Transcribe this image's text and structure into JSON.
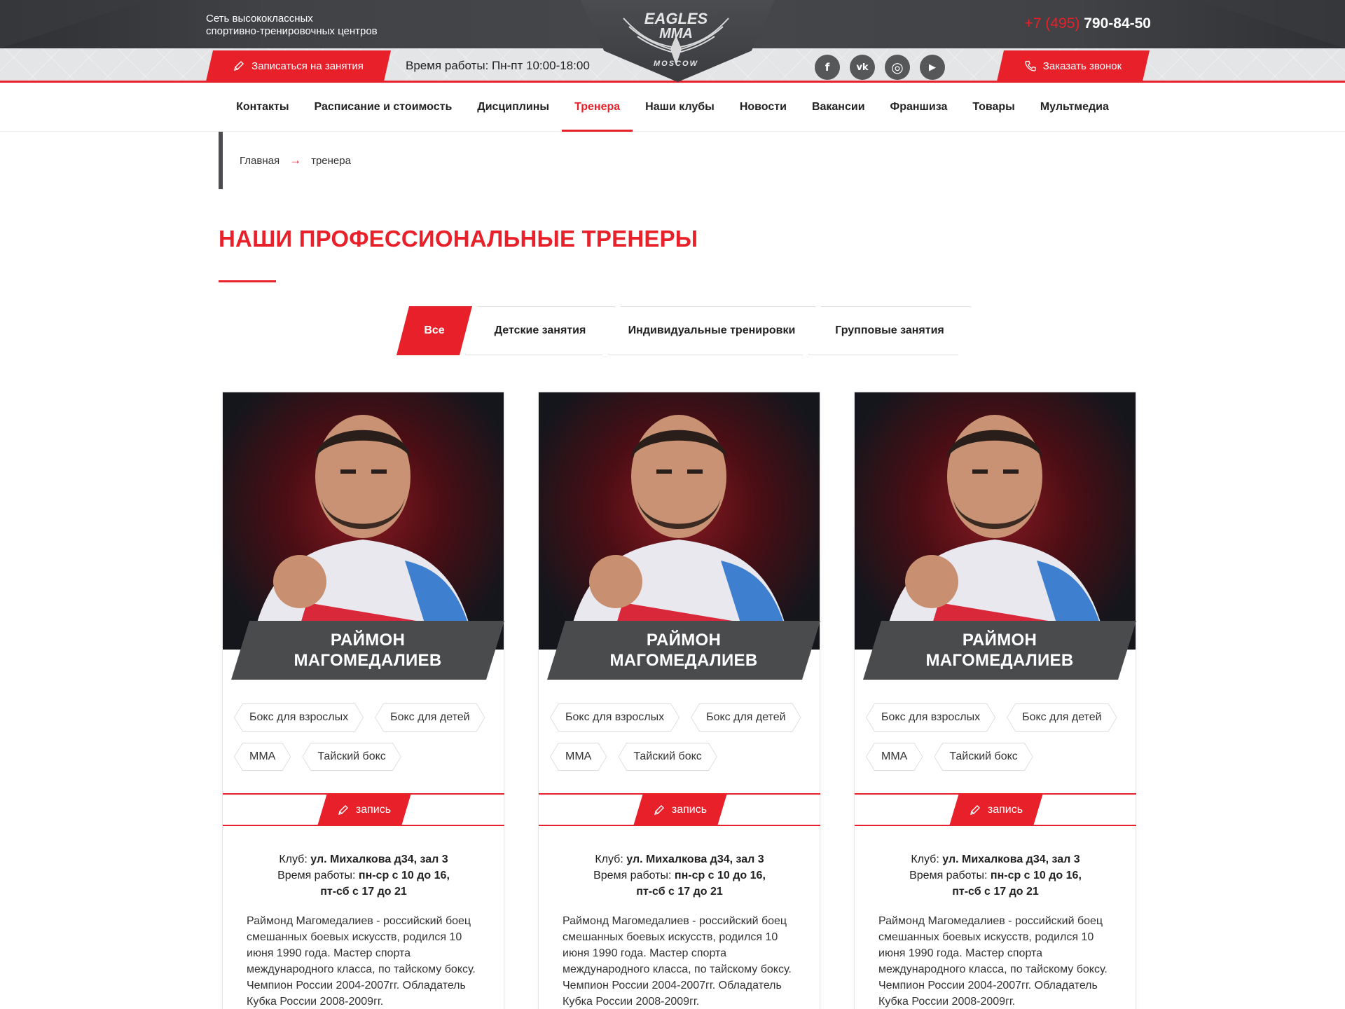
{
  "header": {
    "tagline_line1": "Сеть высококлассных",
    "tagline_line2": "спортивно-тренировочных центров",
    "phone_code": "+7 (495)",
    "phone_number": "790-84-50",
    "signup_label": "Записаться на занятия",
    "hours": "Время работы: Пн-пт 10:00-18:00",
    "callback_label": "Заказать звонок",
    "logo_text_line1": "EAGLES",
    "logo_text_line2": "MMA",
    "logo_text_line3": "MOSCOW",
    "socials": [
      {
        "icon": "facebook-icon",
        "glyph": "f"
      },
      {
        "icon": "vk-icon",
        "glyph": "vk"
      },
      {
        "icon": "instagram-icon",
        "glyph": "◎"
      },
      {
        "icon": "youtube-icon",
        "glyph": "▶"
      }
    ]
  },
  "nav": {
    "items": [
      {
        "label": "Контакты"
      },
      {
        "label": "Расписание и стоимость"
      },
      {
        "label": "Дисциплины"
      },
      {
        "label": "Тренера",
        "active": true
      },
      {
        "label": "Наши клубы"
      },
      {
        "label": "Новости"
      },
      {
        "label": "Вакансии"
      },
      {
        "label": "Франшиза"
      },
      {
        "label": "Товары"
      },
      {
        "label": "Мультмедиа"
      }
    ]
  },
  "breadcrumb": {
    "home": "Главная",
    "arrow": "→",
    "current": "тренера"
  },
  "page": {
    "title": "НАШИ ПРОФЕССИОНАЛЬНЫЕ ТРЕНЕРЫ"
  },
  "filters": {
    "tabs": [
      {
        "label": "Все",
        "active": true
      },
      {
        "label": "Детские занятия"
      },
      {
        "label": "Индивидуальные тренировки"
      },
      {
        "label": "Групповые занятия"
      }
    ]
  },
  "trainers": [
    {
      "name_line1": "РАЙМОН",
      "name_line2": "МАГОМЕДАЛИЕВ",
      "tags": [
        "Бокс для взрослых",
        "Бокс для детей",
        "ММА",
        "Тайский бокс"
      ],
      "record_label": "запись",
      "club_label": "Клуб:",
      "club_value": "ул. Михалкова д34, зал 3",
      "hours_label": "Время работы:",
      "hours_value_1": "пн-ср с 10 до 16,",
      "hours_value_2": "пт-сб с 17 до 21",
      "bio": "Раймонд Магомедалиев - российский боец смешанных боевых искусств, родился 10 июня 1990 года. Мастер спорта международного класса, по тайскому боксу. Чемпион России 2004-2007гг. Обладатель Кубка России 2008-2009гг."
    },
    {
      "name_line1": "РАЙМОН",
      "name_line2": "МАГОМЕДАЛИЕВ",
      "tags": [
        "Бокс для взрослых",
        "Бокс для детей",
        "ММА",
        "Тайский бокс"
      ],
      "record_label": "запись",
      "club_label": "Клуб:",
      "club_value": "ул. Михалкова д34, зал 3",
      "hours_label": "Время работы:",
      "hours_value_1": "пн-ср с 10 до 16,",
      "hours_value_2": "пт-сб с 17 до 21",
      "bio": "Раймонд Магомедалиев - российский боец смешанных боевых искусств, родился 10 июня 1990 года. Мастер спорта международного класса, по тайскому боксу. Чемпион России 2004-2007гг. Обладатель Кубка России 2008-2009гг."
    },
    {
      "name_line1": "РАЙМОН",
      "name_line2": "МАГОМЕДАЛИЕВ",
      "tags": [
        "Бокс для взрослых",
        "Бокс для детей",
        "ММА",
        "Тайский бокс"
      ],
      "record_label": "запись",
      "club_label": "Клуб:",
      "club_value": "ул. Михалкова д34, зал 3",
      "hours_label": "Время работы:",
      "hours_value_1": "пн-ср с 10 до 16,",
      "hours_value_2": "пт-сб с 17 до 21",
      "bio": "Раймонд Магомедалиев - российский боец смешанных боевых искусств, родился 10 июня 1990 года. Мастер спорта международного класса, по тайскому боксу. Чемпион России 2004-2007гг. Обладатель Кубка России 2008-2009гг."
    }
  ],
  "colors": {
    "accent": "#e8202a",
    "dark": "#45474b",
    "plate": "#4a4b4d"
  }
}
